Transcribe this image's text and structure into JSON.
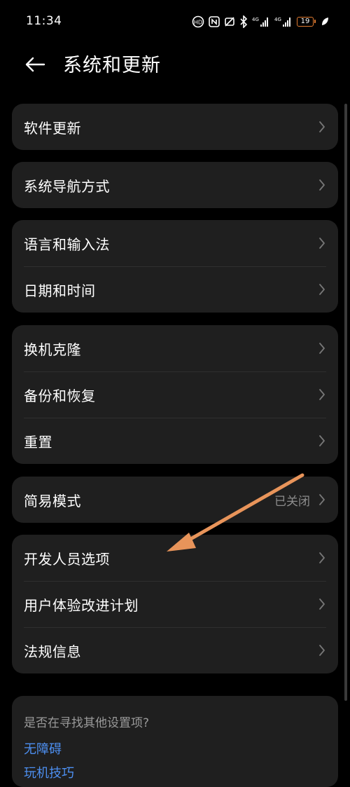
{
  "status_bar": {
    "time": "11:34",
    "battery_level": "19",
    "icons": [
      "wifi-calling-icon",
      "nfc-icon",
      "silent-icon",
      "bluetooth-icon",
      "signal-4g-icon",
      "signal-4g-icon",
      "battery-icon",
      "leaf-icon"
    ],
    "network_label_1": "4G",
    "network_label_2": "4G"
  },
  "header": {
    "title": "系统和更新",
    "back_icon": "arrow-left-icon"
  },
  "groups": [
    {
      "items": [
        {
          "label": "软件更新"
        }
      ]
    },
    {
      "items": [
        {
          "label": "系统导航方式"
        }
      ]
    },
    {
      "items": [
        {
          "label": "语言和输入法"
        },
        {
          "label": "日期和时间"
        }
      ]
    },
    {
      "items": [
        {
          "label": "换机克隆"
        },
        {
          "label": "备份和恢复"
        },
        {
          "label": "重置"
        }
      ]
    },
    {
      "items": [
        {
          "label": "简易模式",
          "value": "已关闭"
        }
      ]
    },
    {
      "items": [
        {
          "label": "开发人员选项"
        },
        {
          "label": "用户体验改进计划"
        },
        {
          "label": "法规信息"
        }
      ]
    }
  ],
  "suggestions": {
    "title": "是否在寻找其他设置项?",
    "links": [
      "无障碍",
      "玩机技巧"
    ]
  },
  "colors": {
    "background": "#000000",
    "card": "#1f1f1f",
    "link": "#4d8ff0",
    "annotation_arrow": "#e8945a",
    "battery_low": "#e07a2f"
  }
}
